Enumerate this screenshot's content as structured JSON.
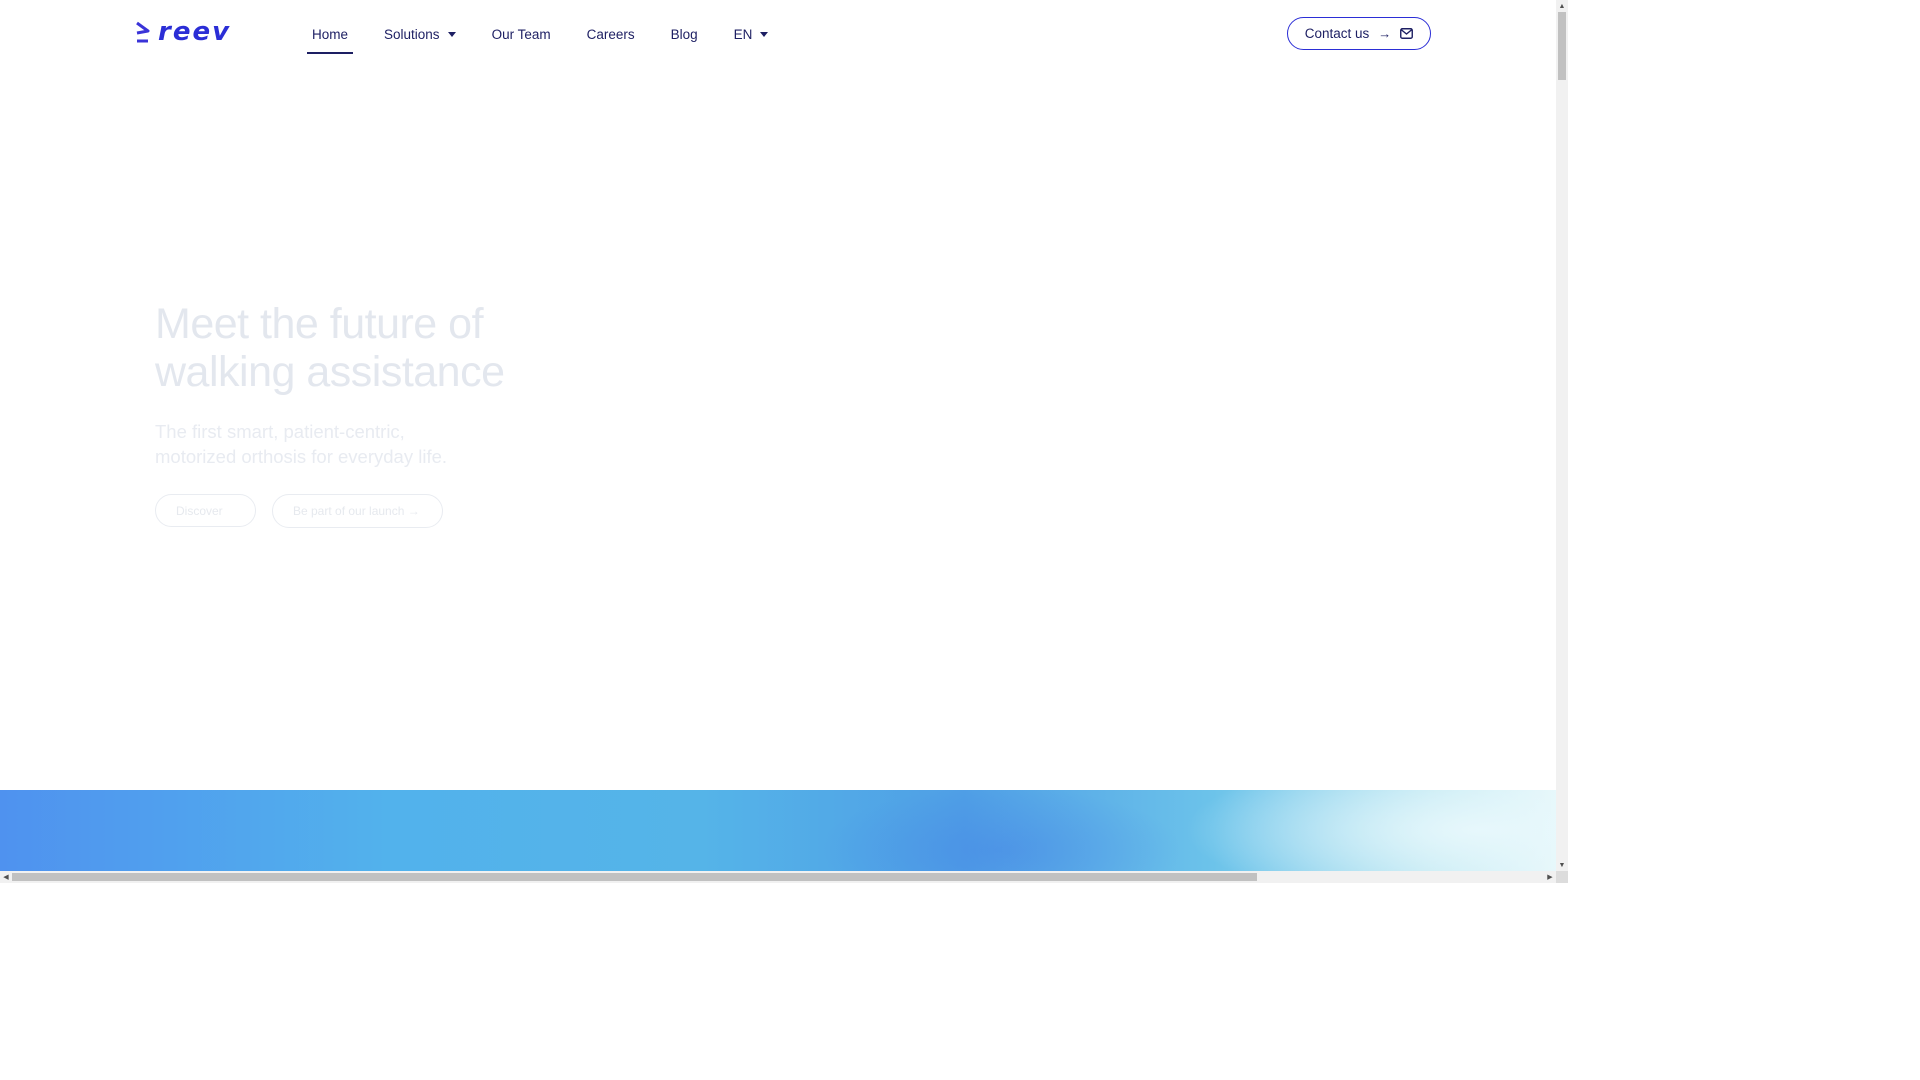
{
  "brand": {
    "name": "reev",
    "color": "#2b2ed6",
    "text_color": "#1d1f63"
  },
  "nav": {
    "items": [
      {
        "label": "Home",
        "active": true,
        "dropdown": false
      },
      {
        "label": "Solutions",
        "active": false,
        "dropdown": true
      },
      {
        "label": "Our Team",
        "active": false,
        "dropdown": false
      },
      {
        "label": "Careers",
        "active": false,
        "dropdown": false
      },
      {
        "label": "Blog",
        "active": false,
        "dropdown": false
      },
      {
        "label": "EN",
        "active": false,
        "dropdown": true
      }
    ],
    "contact": {
      "label": "Contact us",
      "arrow": "→",
      "icon": "mail-icon"
    }
  },
  "hero": {
    "title_line1": "Meet the future of",
    "title_line2": "walking assistance",
    "subtitle": "The first smart, patient-centric, motorized orthosis for everyday life.",
    "discover_label": "Discover",
    "launch_label": "Be part of our launch →"
  },
  "scrollbars": {
    "vertical_arrow_up": "▲",
    "vertical_arrow_down": "▼",
    "horizontal_arrow_left": "◀",
    "horizontal_arrow_right": "▶"
  }
}
